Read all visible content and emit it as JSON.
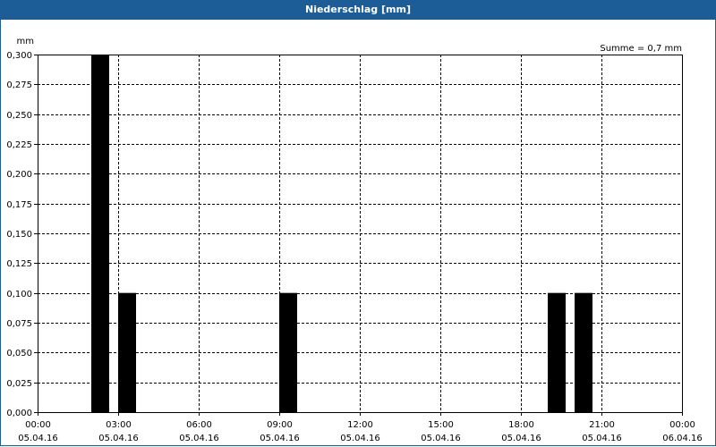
{
  "window": {
    "title": "Niederschlag [mm]"
  },
  "chart_data": {
    "type": "bar",
    "title": "Niederschlag [mm]",
    "annotation": "Summe = 0,7 mm",
    "ylabel": "mm",
    "xlabel": "",
    "ylim": [
      0,
      0.3
    ],
    "yticks": [
      0,
      0.025,
      0.05,
      0.075,
      0.1,
      0.125,
      0.15,
      0.175,
      0.2,
      0.225,
      0.25,
      0.275,
      0.3
    ],
    "ytick_labels": [
      "0,000",
      "0,025",
      "0,050",
      "0,075",
      "0,100",
      "0,125",
      "0,150",
      "0,175",
      "0,200",
      "0,225",
      "0,250",
      "0,275",
      "0,300"
    ],
    "x_range_hours": [
      0,
      24
    ],
    "xticks_hours": [
      0,
      3,
      6,
      9,
      12,
      15,
      18,
      21,
      24
    ],
    "xtick_labels": [
      {
        "time": "00:00",
        "date": "05.04.16"
      },
      {
        "time": "03:00",
        "date": "05.04.16"
      },
      {
        "time": "06:00",
        "date": "05.04.16"
      },
      {
        "time": "09:00",
        "date": "05.04.16"
      },
      {
        "time": "12:00",
        "date": "05.04.16"
      },
      {
        "time": "15:00",
        "date": "05.04.16"
      },
      {
        "time": "18:00",
        "date": "05.04.16"
      },
      {
        "time": "21:00",
        "date": "05.04.16"
      },
      {
        "time": "00:00",
        "date": "06.04.16"
      }
    ],
    "bars": [
      {
        "start_hour": 2.0,
        "end_hour": 2.667,
        "value": 0.3
      },
      {
        "start_hour": 3.0,
        "end_hour": 3.667,
        "value": 0.1
      },
      {
        "start_hour": 9.0,
        "end_hour": 9.667,
        "value": 0.1
      },
      {
        "start_hour": 19.0,
        "end_hour": 19.667,
        "value": 0.1
      },
      {
        "start_hour": 20.0,
        "end_hour": 20.667,
        "value": 0.1
      }
    ],
    "grid": true,
    "colors": {
      "bar": "#000000",
      "grid": "#000000",
      "title_bar": "#1c5d97",
      "title_text": "#ffffff"
    }
  }
}
